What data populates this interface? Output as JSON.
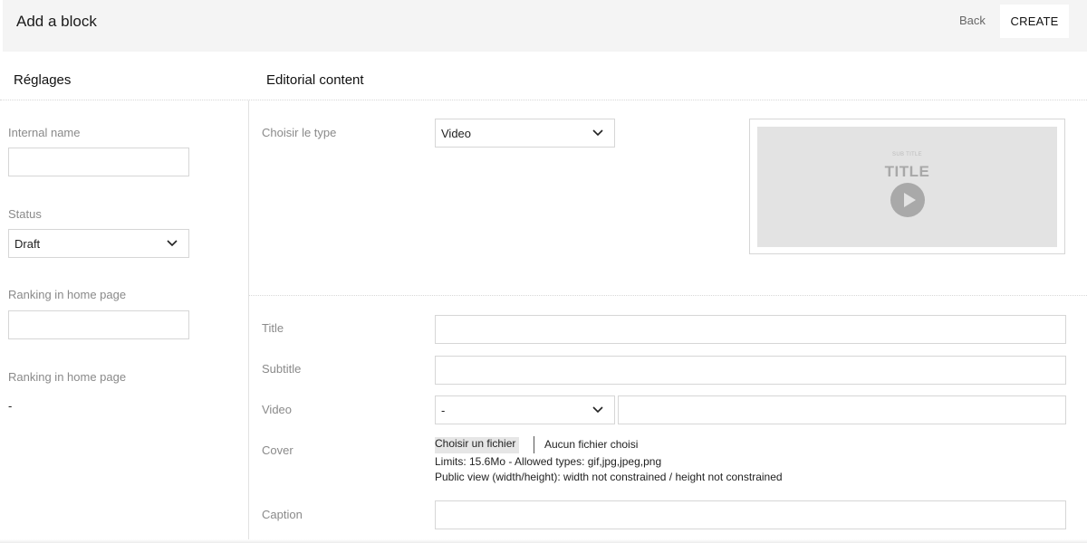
{
  "header": {
    "title": "Add a block",
    "back_label": "Back",
    "create_label": "CREATE"
  },
  "settings": {
    "title": "Réglages",
    "internal_name": {
      "label": "Internal name",
      "value": ""
    },
    "status": {
      "label": "Status",
      "value": "Draft"
    },
    "ranking_input": {
      "label": "Ranking in home page",
      "value": ""
    },
    "ranking_display": {
      "label": "Ranking in home page",
      "value": "-"
    }
  },
  "editorial": {
    "title": "Editorial content",
    "type": {
      "label": "Choisir le type",
      "value": "Video"
    },
    "preview": {
      "subtitle": "SUB TITLE",
      "title": "TITLE",
      "icon": "play-icon"
    },
    "fields": {
      "title": {
        "label": "Title",
        "value": ""
      },
      "subtitle": {
        "label": "Subtitle",
        "value": ""
      },
      "video": {
        "label": "Video",
        "select_value": "-",
        "url_value": ""
      },
      "cover": {
        "label": "Cover",
        "button_label": "Choisir un fichier",
        "status": "Aucun fichier choisi",
        "limits": "Limits: 15.6Mo - Allowed types: gif,jpg,jpeg,png",
        "public_view": "Public view (width/height): width not constrained / height not constrained"
      },
      "caption": {
        "label": "Caption",
        "value": ""
      }
    }
  }
}
